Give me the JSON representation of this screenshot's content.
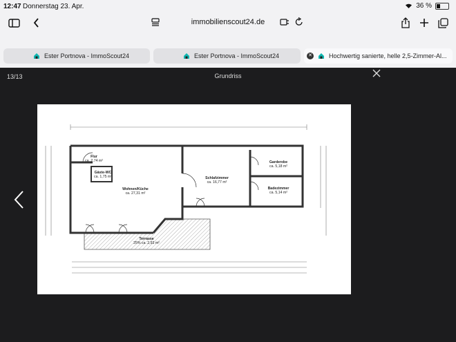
{
  "status": {
    "time": "12:47",
    "date": "Donnerstag 23. Apr.",
    "battery": "36 %"
  },
  "browser": {
    "domain": "immobilienscout24.de",
    "tabs": [
      {
        "label": "Ester Portnova - ImmoScout24"
      },
      {
        "label": "Ester Portnova - ImmoScout24"
      },
      {
        "label": "Hochwertig sanierte, helle 2,5-Zimmer-Al..."
      }
    ]
  },
  "viewer": {
    "counter": "13/13",
    "title": "Grundriss"
  },
  "floorplan": {
    "rooms": {
      "flur": {
        "name": "Flur",
        "area": "ca. 2,74 m²"
      },
      "gaeste_wc": {
        "name": "Gäste-WC",
        "area": "ca. 1,75 m²"
      },
      "wohnen": {
        "name": "Wohnen/Küche",
        "area": "ca. 27,31 m²"
      },
      "schlafen": {
        "name": "Schlafzimmer",
        "area": "ca. 16,77 m²"
      },
      "garderobe": {
        "name": "Garderobe",
        "area": "ca. 5,18 m²"
      },
      "bad": {
        "name": "Badezimmer",
        "area": "ca. 5,14 m²"
      },
      "terrasse": {
        "name": "Terrasse",
        "area": "25% ca. 2,93 m²"
      }
    }
  },
  "colors": {
    "accent": "#0fb6b0",
    "background": "#1c1c1e",
    "chrome": "#f2f2f4"
  }
}
